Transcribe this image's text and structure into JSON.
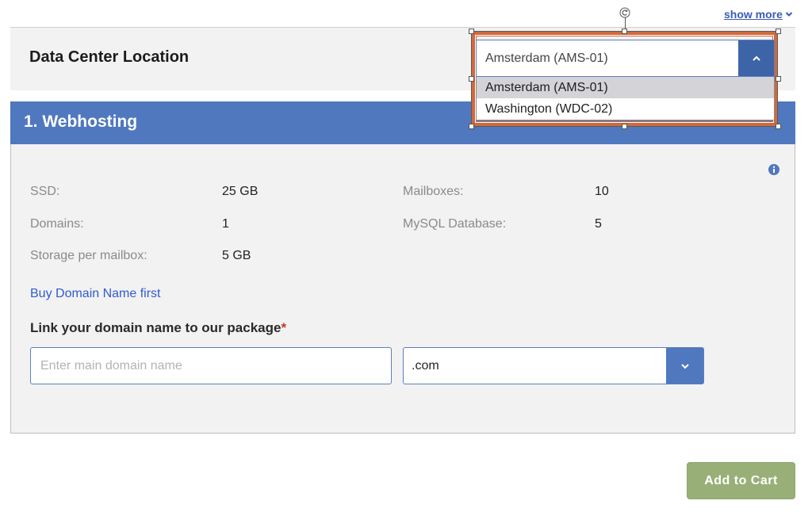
{
  "header": {
    "show_more_label": "show more"
  },
  "data_center": {
    "title": "Data Center Location",
    "selected": "Amsterdam (AMS-01)",
    "options": [
      "Amsterdam (AMS-01)",
      "Washington (WDC-02)"
    ]
  },
  "webhosting": {
    "title": "1. Webhosting",
    "specs": {
      "ssd_label": "SSD:",
      "ssd_value": "25 GB",
      "domains_label": "Domains:",
      "domains_value": "1",
      "storage_label": "Storage per mailbox:",
      "storage_value": "5 GB",
      "mailboxes_label": "Mailboxes:",
      "mailboxes_value": "10",
      "mysql_label": "MySQL Database:",
      "mysql_value": "5"
    },
    "buy_domain_link": "Buy Domain Name first",
    "link_label": "Link your domain name to our package",
    "required_mark": "*",
    "domain_placeholder": "Enter main domain name",
    "tld_selected": ".com"
  },
  "actions": {
    "add_to_cart": "Add to Cart"
  },
  "colors": {
    "header_blue": "#4f78bf",
    "add_to_cart_green": "#98b077",
    "selection_orange": "#d2693b"
  },
  "icons": [
    "chevron-down-icon",
    "chevron-up-icon",
    "info-icon",
    "rotate-handle-icon"
  ]
}
